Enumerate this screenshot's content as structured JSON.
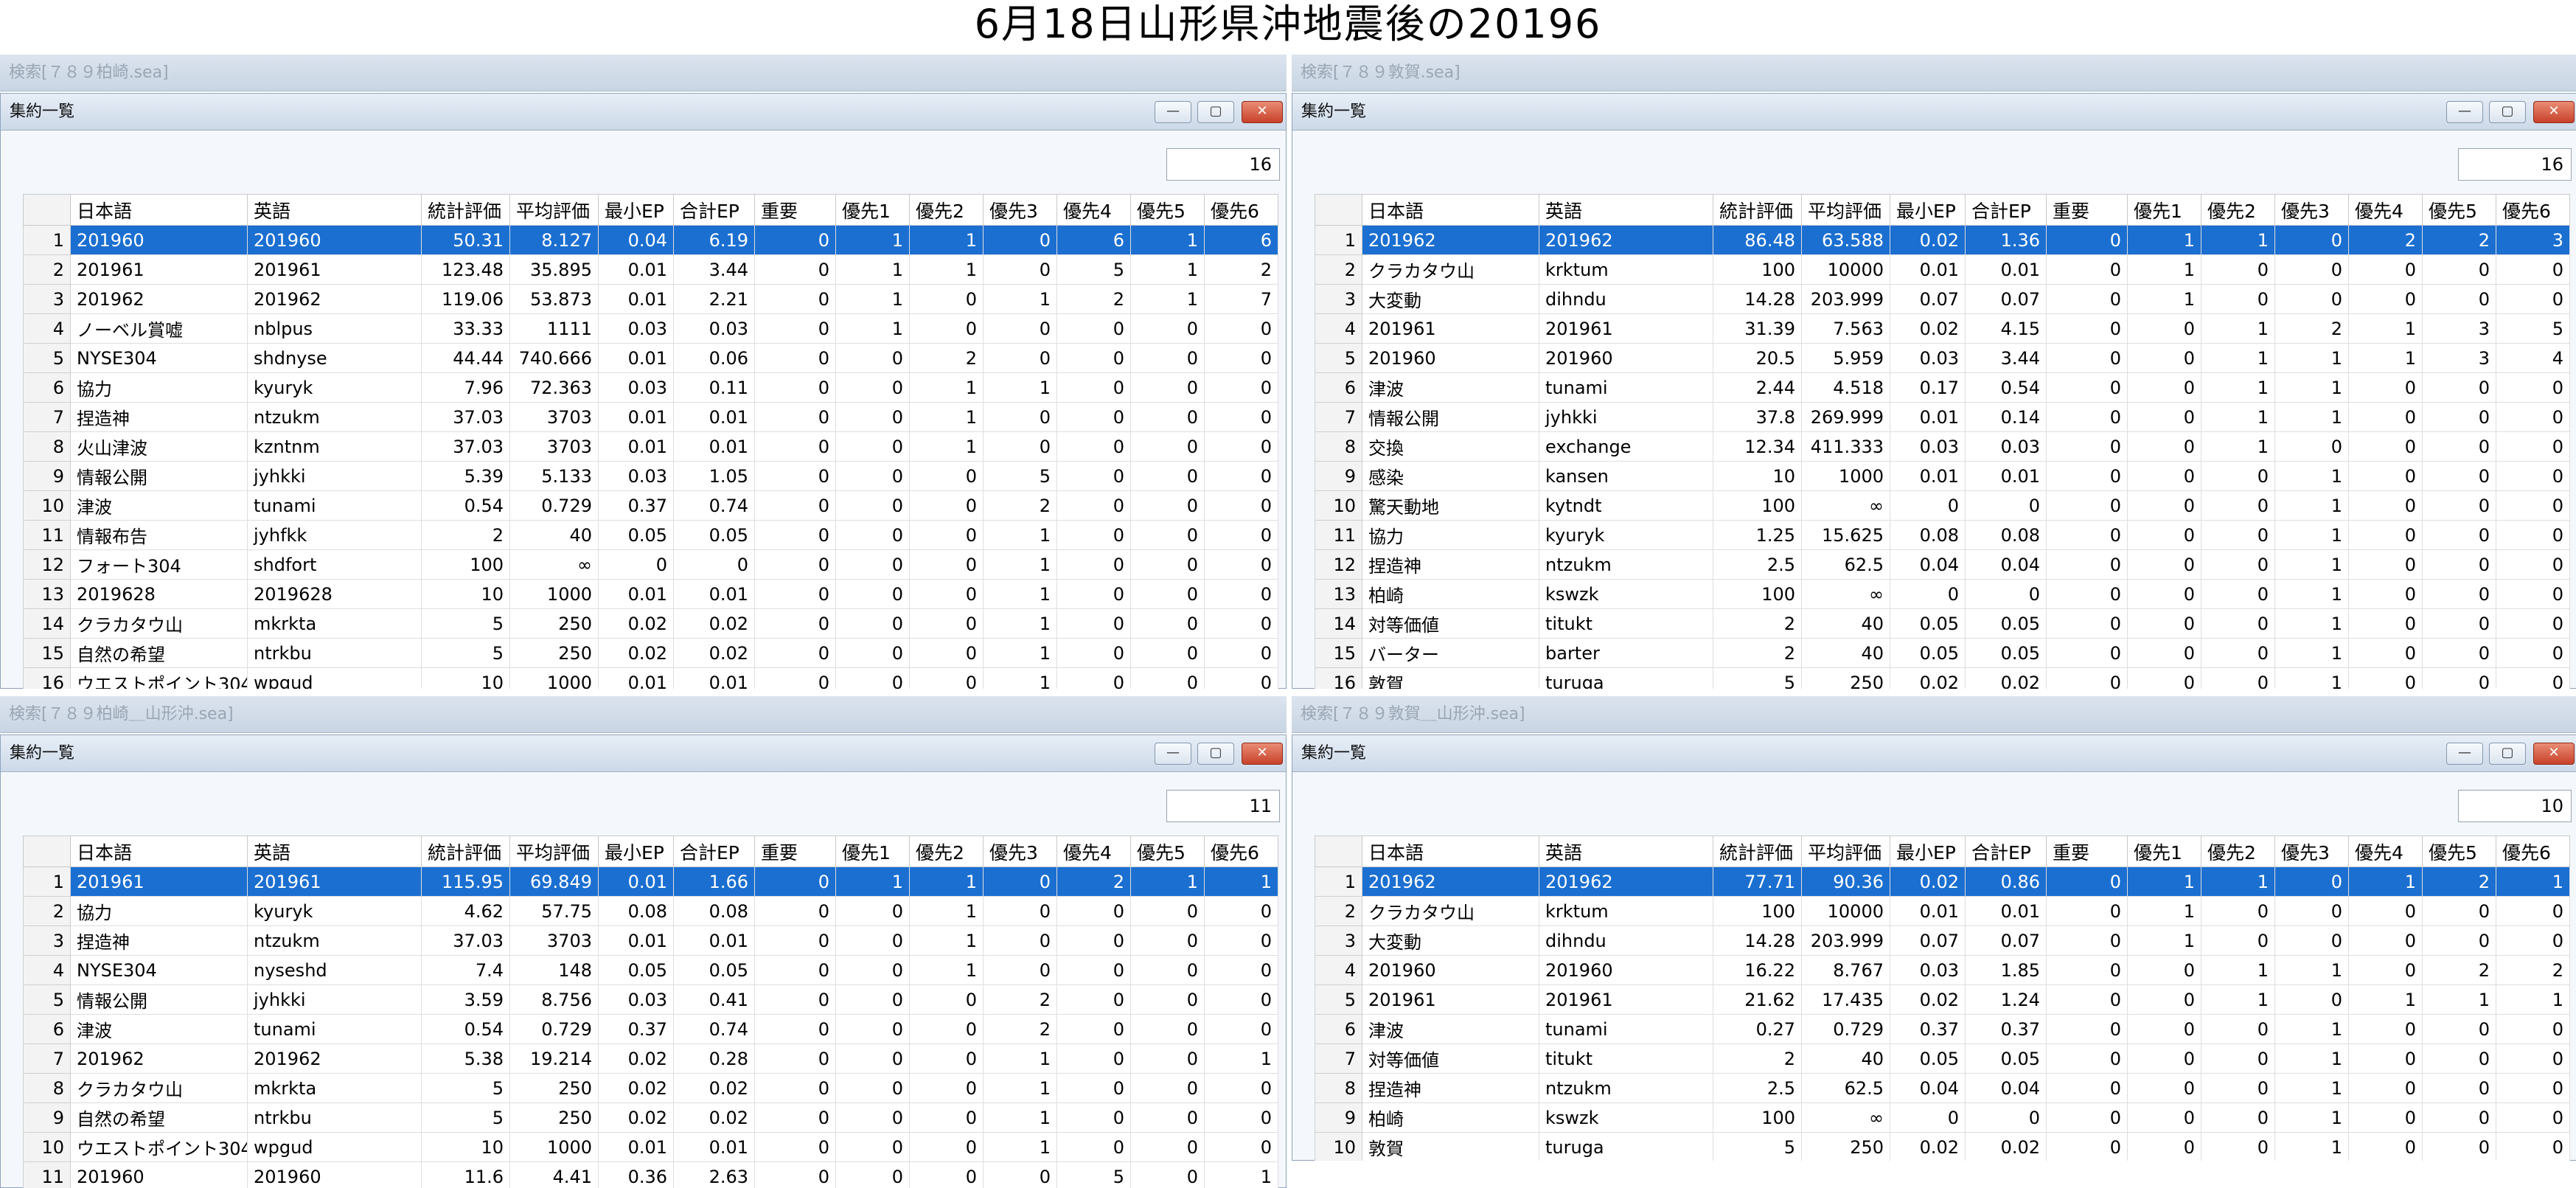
{
  "page_title": "6月18日山形県沖地震後の20196",
  "column_headers": [
    "日本語",
    "英語",
    "統計評価",
    "平均評価",
    "最小EP",
    "合計EP",
    "重要",
    "優先1",
    "優先2",
    "優先3",
    "優先4",
    "優先5",
    "優先6"
  ],
  "window_buttons": {
    "minimize": "—",
    "maximize": "▢",
    "close": "✕"
  },
  "panels": [
    {
      "search_title": "検索[７８９柏崎.sea]",
      "window_title": "集約一覧",
      "count": "16",
      "rows": [
        [
          "1",
          "201960",
          "201960",
          "50.31",
          "8.127",
          "0.04",
          "6.19",
          "0",
          "1",
          "1",
          "0",
          "6",
          "1",
          "6"
        ],
        [
          "2",
          "201961",
          "201961",
          "123.48",
          "35.895",
          "0.01",
          "3.44",
          "0",
          "1",
          "1",
          "0",
          "5",
          "1",
          "2"
        ],
        [
          "3",
          "201962",
          "201962",
          "119.06",
          "53.873",
          "0.01",
          "2.21",
          "0",
          "1",
          "0",
          "1",
          "2",
          "1",
          "7"
        ],
        [
          "4",
          "ノーベル賞嘘",
          "nblpus",
          "33.33",
          "1111",
          "0.03",
          "0.03",
          "0",
          "1",
          "0",
          "0",
          "0",
          "0",
          "0"
        ],
        [
          "5",
          "NYSE304",
          "shdnyse",
          "44.44",
          "740.666",
          "0.01",
          "0.06",
          "0",
          "0",
          "2",
          "0",
          "0",
          "0",
          "0"
        ],
        [
          "6",
          "協力",
          "kyuryk",
          "7.96",
          "72.363",
          "0.03",
          "0.11",
          "0",
          "0",
          "1",
          "1",
          "0",
          "0",
          "0"
        ],
        [
          "7",
          "捏造神",
          "ntzukm",
          "37.03",
          "3703",
          "0.01",
          "0.01",
          "0",
          "0",
          "1",
          "0",
          "0",
          "0",
          "0"
        ],
        [
          "8",
          "火山津波",
          "kzntnm",
          "37.03",
          "3703",
          "0.01",
          "0.01",
          "0",
          "0",
          "1",
          "0",
          "0",
          "0",
          "0"
        ],
        [
          "9",
          "情報公開",
          "jyhkki",
          "5.39",
          "5.133",
          "0.03",
          "1.05",
          "0",
          "0",
          "0",
          "5",
          "0",
          "0",
          "0"
        ],
        [
          "10",
          "津波",
          "tunami",
          "0.54",
          "0.729",
          "0.37",
          "0.74",
          "0",
          "0",
          "0",
          "2",
          "0",
          "0",
          "0"
        ],
        [
          "11",
          "情報布告",
          "jyhfkk",
          "2",
          "40",
          "0.05",
          "0.05",
          "0",
          "0",
          "0",
          "1",
          "0",
          "0",
          "0"
        ],
        [
          "12",
          "フォート304",
          "shdfort",
          "100",
          "∞",
          "0",
          "0",
          "0",
          "0",
          "0",
          "1",
          "0",
          "0",
          "0"
        ],
        [
          "13",
          "2019628",
          "2019628",
          "10",
          "1000",
          "0.01",
          "0.01",
          "0",
          "0",
          "0",
          "1",
          "0",
          "0",
          "0"
        ],
        [
          "14",
          "クラカタウ山",
          "mkrkta",
          "5",
          "250",
          "0.02",
          "0.02",
          "0",
          "0",
          "0",
          "1",
          "0",
          "0",
          "0"
        ],
        [
          "15",
          "自然の希望",
          "ntrkbu",
          "5",
          "250",
          "0.02",
          "0.02",
          "0",
          "0",
          "0",
          "1",
          "0",
          "0",
          "0"
        ],
        [
          "16",
          "ウエストポイント304",
          "wpgud",
          "10",
          "1000",
          "0.01",
          "0.01",
          "0",
          "0",
          "0",
          "1",
          "0",
          "0",
          "0"
        ]
      ]
    },
    {
      "search_title": "検索[７８９敦賀.sea]",
      "window_title": "集約一覧",
      "count": "16",
      "rows": [
        [
          "1",
          "201962",
          "201962",
          "86.48",
          "63.588",
          "0.02",
          "1.36",
          "0",
          "1",
          "1",
          "0",
          "2",
          "2",
          "3"
        ],
        [
          "2",
          "クラカタウ山",
          "krktum",
          "100",
          "10000",
          "0.01",
          "0.01",
          "0",
          "1",
          "0",
          "0",
          "0",
          "0",
          "0"
        ],
        [
          "3",
          "大変動",
          "dihndu",
          "14.28",
          "203.999",
          "0.07",
          "0.07",
          "0",
          "1",
          "0",
          "0",
          "0",
          "0",
          "0"
        ],
        [
          "4",
          "201961",
          "201961",
          "31.39",
          "7.563",
          "0.02",
          "4.15",
          "0",
          "0",
          "1",
          "2",
          "1",
          "3",
          "5"
        ],
        [
          "5",
          "201960",
          "201960",
          "20.5",
          "5.959",
          "0.03",
          "3.44",
          "0",
          "0",
          "1",
          "1",
          "1",
          "3",
          "4"
        ],
        [
          "6",
          "津波",
          "tunami",
          "2.44",
          "4.518",
          "0.17",
          "0.54",
          "0",
          "0",
          "1",
          "1",
          "0",
          "0",
          "0"
        ],
        [
          "7",
          "情報公開",
          "jyhkki",
          "37.8",
          "269.999",
          "0.01",
          "0.14",
          "0",
          "0",
          "1",
          "1",
          "0",
          "0",
          "0"
        ],
        [
          "8",
          "交換",
          "exchange",
          "12.34",
          "411.333",
          "0.03",
          "0.03",
          "0",
          "0",
          "1",
          "0",
          "0",
          "0",
          "0"
        ],
        [
          "9",
          "感染",
          "kansen",
          "10",
          "1000",
          "0.01",
          "0.01",
          "0",
          "0",
          "0",
          "1",
          "0",
          "0",
          "0"
        ],
        [
          "10",
          "驚天動地",
          "kytndt",
          "100",
          "∞",
          "0",
          "0",
          "0",
          "0",
          "0",
          "1",
          "0",
          "0",
          "0"
        ],
        [
          "11",
          "協力",
          "kyuryk",
          "1.25",
          "15.625",
          "0.08",
          "0.08",
          "0",
          "0",
          "0",
          "1",
          "0",
          "0",
          "0"
        ],
        [
          "12",
          "捏造神",
          "ntzukm",
          "2.5",
          "62.5",
          "0.04",
          "0.04",
          "0",
          "0",
          "0",
          "1",
          "0",
          "0",
          "0"
        ],
        [
          "13",
          "柏崎",
          "kswzk",
          "100",
          "∞",
          "0",
          "0",
          "0",
          "0",
          "0",
          "1",
          "0",
          "0",
          "0"
        ],
        [
          "14",
          "対等価値",
          "titukt",
          "2",
          "40",
          "0.05",
          "0.05",
          "0",
          "0",
          "0",
          "1",
          "0",
          "0",
          "0"
        ],
        [
          "15",
          "バーター",
          "barter",
          "2",
          "40",
          "0.05",
          "0.05",
          "0",
          "0",
          "0",
          "1",
          "0",
          "0",
          "0"
        ],
        [
          "16",
          "敦賀",
          "turuga",
          "5",
          "250",
          "0.02",
          "0.02",
          "0",
          "0",
          "0",
          "1",
          "0",
          "0",
          "0"
        ]
      ]
    },
    {
      "search_title": "検索[７８９柏崎＿山形沖.sea]",
      "window_title": "集約一覧",
      "count": "11",
      "rows": [
        [
          "1",
          "201961",
          "201961",
          "115.95",
          "69.849",
          "0.01",
          "1.66",
          "0",
          "1",
          "1",
          "0",
          "2",
          "1",
          "1"
        ],
        [
          "2",
          "協力",
          "kyuryk",
          "4.62",
          "57.75",
          "0.08",
          "0.08",
          "0",
          "0",
          "1",
          "0",
          "0",
          "0",
          "0"
        ],
        [
          "3",
          "捏造神",
          "ntzukm",
          "37.03",
          "3703",
          "0.01",
          "0.01",
          "0",
          "0",
          "1",
          "0",
          "0",
          "0",
          "0"
        ],
        [
          "4",
          "NYSE304",
          "nyseshd",
          "7.4",
          "148",
          "0.05",
          "0.05",
          "0",
          "0",
          "1",
          "0",
          "0",
          "0",
          "0"
        ],
        [
          "5",
          "情報公開",
          "jyhkki",
          "3.59",
          "8.756",
          "0.03",
          "0.41",
          "0",
          "0",
          "0",
          "2",
          "0",
          "0",
          "0"
        ],
        [
          "6",
          "津波",
          "tunami",
          "0.54",
          "0.729",
          "0.37",
          "0.74",
          "0",
          "0",
          "0",
          "2",
          "0",
          "0",
          "0"
        ],
        [
          "7",
          "201962",
          "201962",
          "5.38",
          "19.214",
          "0.02",
          "0.28",
          "0",
          "0",
          "0",
          "1",
          "0",
          "0",
          "1"
        ],
        [
          "8",
          "クラカタウ山",
          "mkrkta",
          "5",
          "250",
          "0.02",
          "0.02",
          "0",
          "0",
          "0",
          "1",
          "0",
          "0",
          "0"
        ],
        [
          "9",
          "自然の希望",
          "ntrkbu",
          "5",
          "250",
          "0.02",
          "0.02",
          "0",
          "0",
          "0",
          "1",
          "0",
          "0",
          "0"
        ],
        [
          "10",
          "ウエストポイント304",
          "wpgud",
          "10",
          "1000",
          "0.01",
          "0.01",
          "0",
          "0",
          "0",
          "1",
          "0",
          "0",
          "0"
        ],
        [
          "11",
          "201960",
          "201960",
          "11.6",
          "4.41",
          "0.36",
          "2.63",
          "0",
          "0",
          "0",
          "0",
          "5",
          "0",
          "1"
        ]
      ]
    },
    {
      "search_title": "検索[７８９敦賀＿山形沖.sea]",
      "window_title": "集約一覧",
      "count": "10",
      "rows": [
        [
          "1",
          "201962",
          "201962",
          "77.71",
          "90.36",
          "0.02",
          "0.86",
          "0",
          "1",
          "1",
          "0",
          "1",
          "2",
          "1"
        ],
        [
          "2",
          "クラカタウ山",
          "krktum",
          "100",
          "10000",
          "0.01",
          "0.01",
          "0",
          "1",
          "0",
          "0",
          "0",
          "0",
          "0"
        ],
        [
          "3",
          "大変動",
          "dihndu",
          "14.28",
          "203.999",
          "0.07",
          "0.07",
          "0",
          "1",
          "0",
          "0",
          "0",
          "0",
          "0"
        ],
        [
          "4",
          "201960",
          "201960",
          "16.22",
          "8.767",
          "0.03",
          "1.85",
          "0",
          "0",
          "1",
          "1",
          "0",
          "2",
          "2"
        ],
        [
          "5",
          "201961",
          "201961",
          "21.62",
          "17.435",
          "0.02",
          "1.24",
          "0",
          "0",
          "1",
          "0",
          "1",
          "1",
          "1"
        ],
        [
          "6",
          "津波",
          "tunami",
          "0.27",
          "0.729",
          "0.37",
          "0.37",
          "0",
          "0",
          "0",
          "1",
          "0",
          "0",
          "0"
        ],
        [
          "7",
          "対等価値",
          "titukt",
          "2",
          "40",
          "0.05",
          "0.05",
          "0",
          "0",
          "0",
          "1",
          "0",
          "0",
          "0"
        ],
        [
          "8",
          "捏造神",
          "ntzukm",
          "2.5",
          "62.5",
          "0.04",
          "0.04",
          "0",
          "0",
          "0",
          "1",
          "0",
          "0",
          "0"
        ],
        [
          "9",
          "柏崎",
          "kswzk",
          "100",
          "∞",
          "0",
          "0",
          "0",
          "0",
          "0",
          "1",
          "0",
          "0",
          "0"
        ],
        [
          "10",
          "敦賀",
          "turuga",
          "5",
          "250",
          "0.02",
          "0.02",
          "0",
          "0",
          "0",
          "1",
          "0",
          "0",
          "0"
        ]
      ]
    }
  ]
}
